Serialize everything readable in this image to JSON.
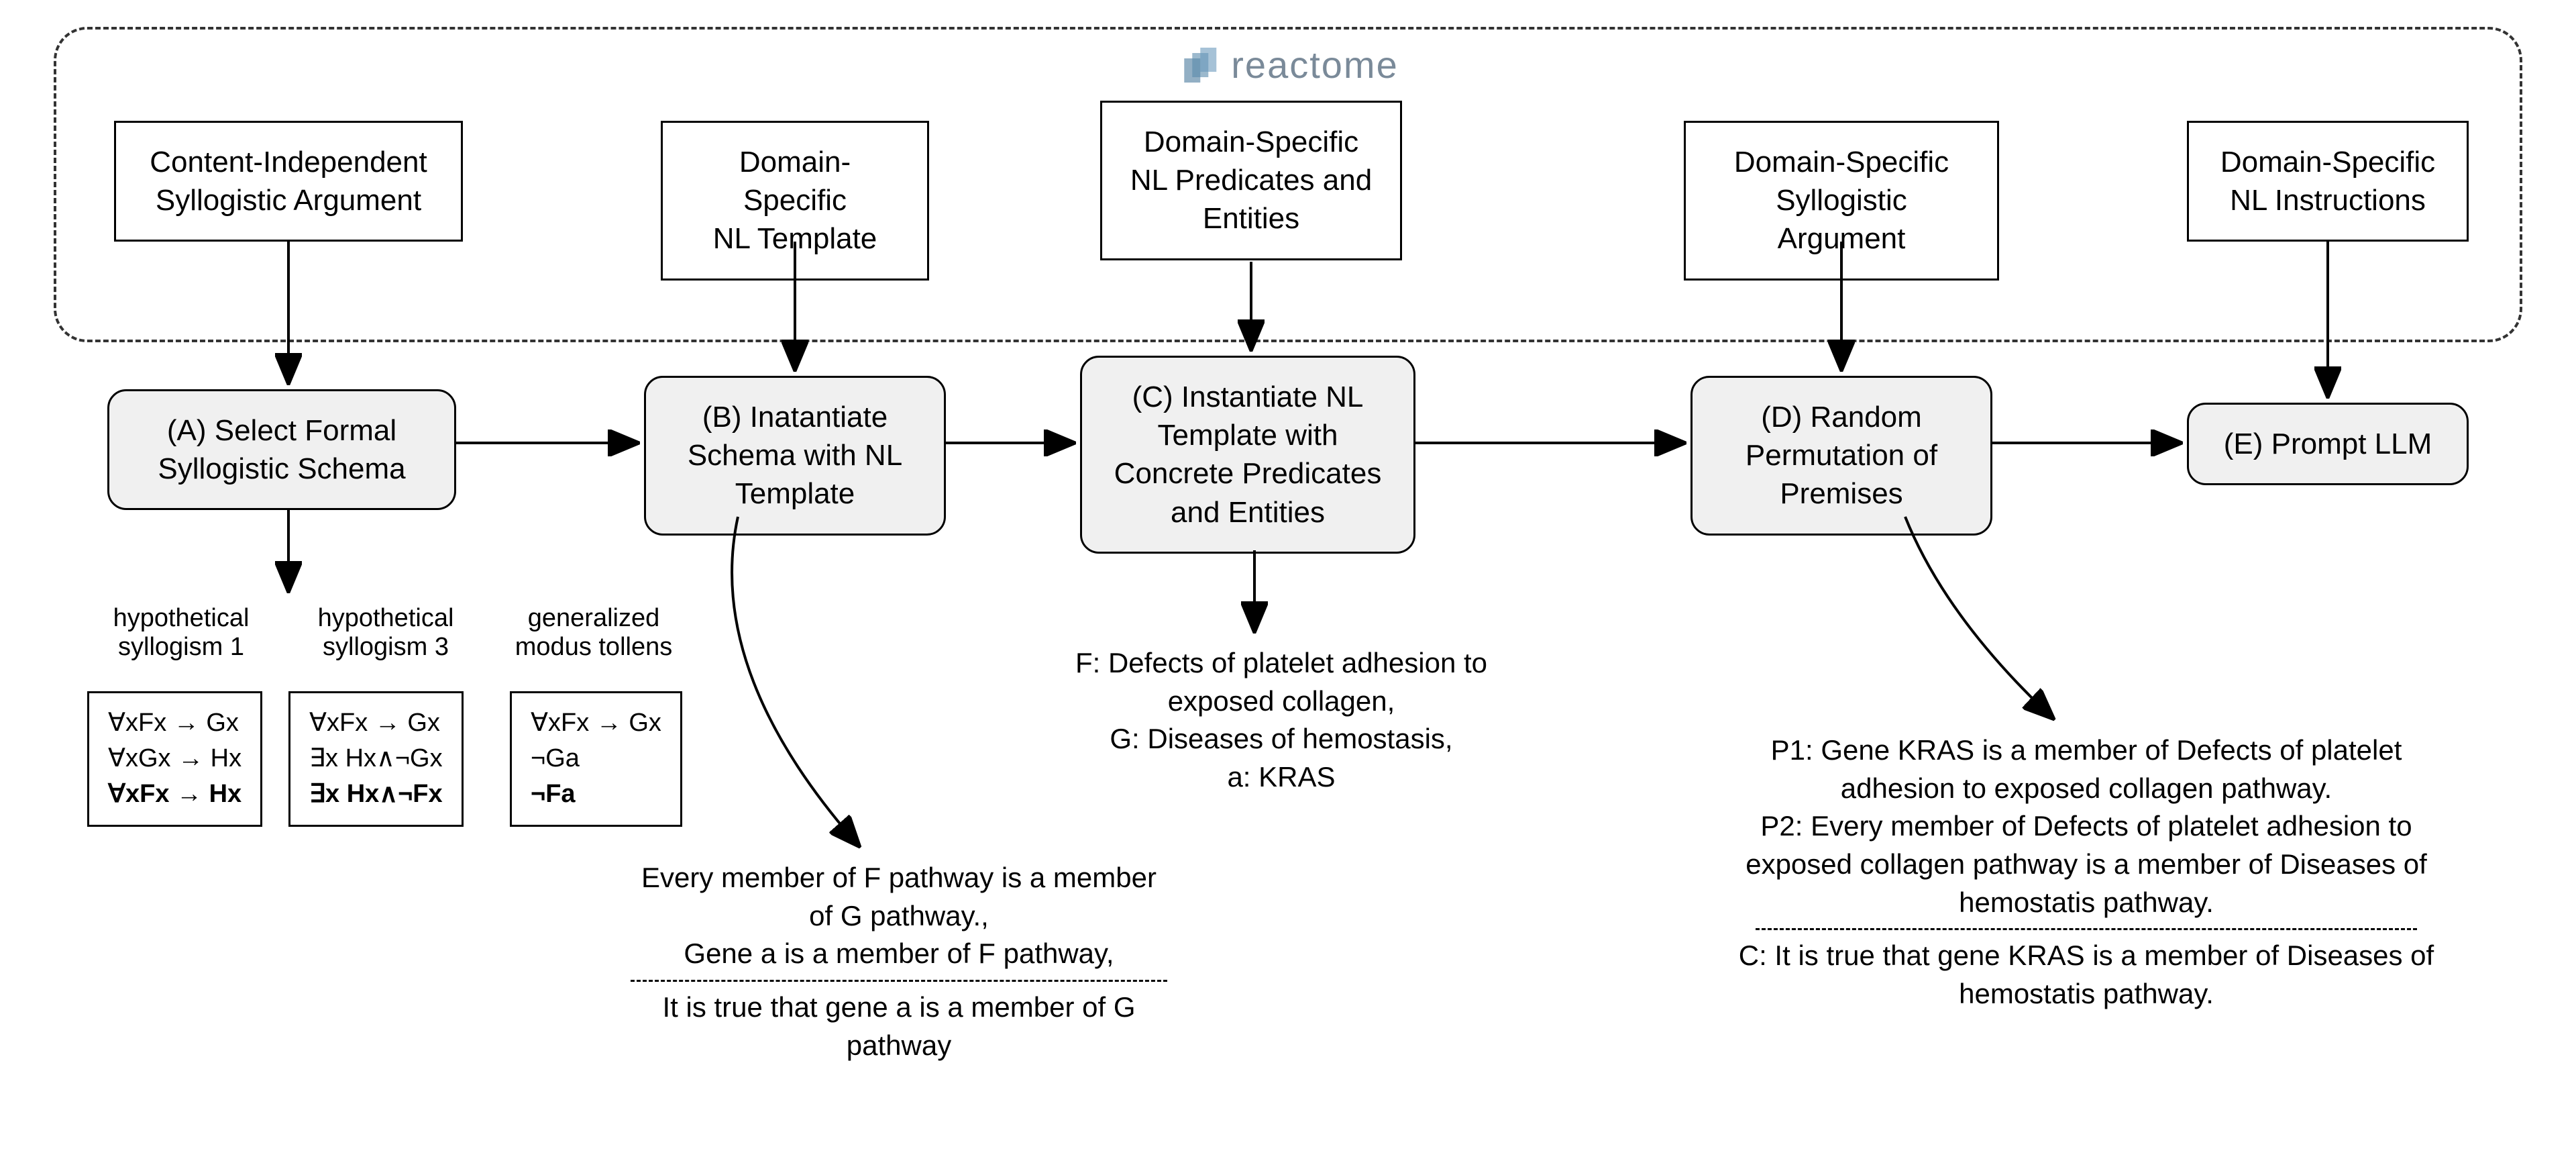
{
  "logo": {
    "text": "reactome"
  },
  "inputs": {
    "a": "Content-Independent\nSyllogistic Argument",
    "b": "Domain-Specific\nNL Template",
    "c": "Domain-Specific\nNL Predicates and\nEntities",
    "d": "Domain-Specific\nSyllogistic Argument",
    "e": "Domain-Specific\nNL Instructions"
  },
  "processes": {
    "a": "(A) Select Formal\nSyllogistic Schema",
    "b": "(B) Inatantiate\nSchema with NL\nTemplate",
    "c": "(C) Instantiate NL\nTemplate with\nConcrete Predicates\nand Entities",
    "d": "(D) Random\nPermutation of\nPremises",
    "e": "(E) Prompt LLM"
  },
  "schemas": {
    "s1": {
      "label": "hypothetical\nsyllogism 1",
      "lines": [
        "∀xFx → Gx",
        "∀xGx → Hx"
      ],
      "conclusion": "∀xFx → Hx"
    },
    "s2": {
      "label": "hypothetical\nsyllogism 3",
      "lines": [
        "∀xFx → Gx",
        "∃x Hx∧¬Gx"
      ],
      "conclusion": "∃x Hx∧¬Fx"
    },
    "s3": {
      "label": "generalized\nmodus tollens",
      "lines": [
        "∀xFx → Gx",
        "¬Ga"
      ],
      "conclusion": "¬Fa"
    }
  },
  "exampleB": {
    "premise1": "Every member of F pathway is a member",
    "premise2": "of G pathway.,",
    "premise3": "Gene a is a member of F pathway,",
    "conclusion1": "It is true that gene a is a member of G",
    "conclusion2": "pathway"
  },
  "exampleC": {
    "line1": "F: Defects of platelet adhesion to",
    "line2": "exposed collagen,",
    "line3": "G: Diseases of hemostasis,",
    "line4": "a: KRAS"
  },
  "exampleD": {
    "p1a": "P1: Gene KRAS is a member of Defects of platelet",
    "p1b": "adhesion to exposed collagen pathway.",
    "p2a": "P2: Every member of Defects of platelet adhesion to",
    "p2b": "exposed collagen pathway is a member of Diseases of",
    "p2c": "hemostatis pathway.",
    "c1": "C: It is true that gene KRAS is a member of Diseases of",
    "c2": "hemostatis pathway."
  }
}
